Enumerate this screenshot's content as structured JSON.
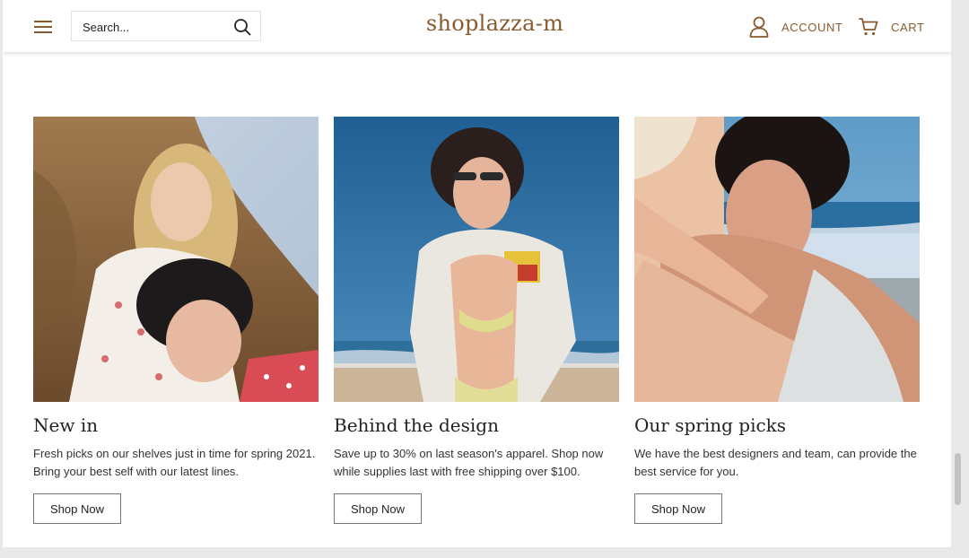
{
  "header": {
    "menu_icon": "hamburger-menu-icon",
    "search": {
      "placeholder": "Search...",
      "icon": "search-icon"
    },
    "brand": "shoplazza-m",
    "account_label": "ACCOUNT",
    "cart_label": "CART",
    "accent_color": "#8a5a2f"
  },
  "cards": [
    {
      "title": "New in",
      "description": "Fresh picks on our shelves just in time for spring 2021. Bring your best self with our latest lines.",
      "button_label": "Shop Now"
    },
    {
      "title": "Behind the design",
      "description": "Save up to 30% on last season's apparel. Shop now while supplies last with free shipping over $100.",
      "button_label": "Shop Now"
    },
    {
      "title": "Our spring picks",
      "description": "We have the best designers and team, can provide the best service for you.",
      "button_label": "Shop Now"
    }
  ]
}
